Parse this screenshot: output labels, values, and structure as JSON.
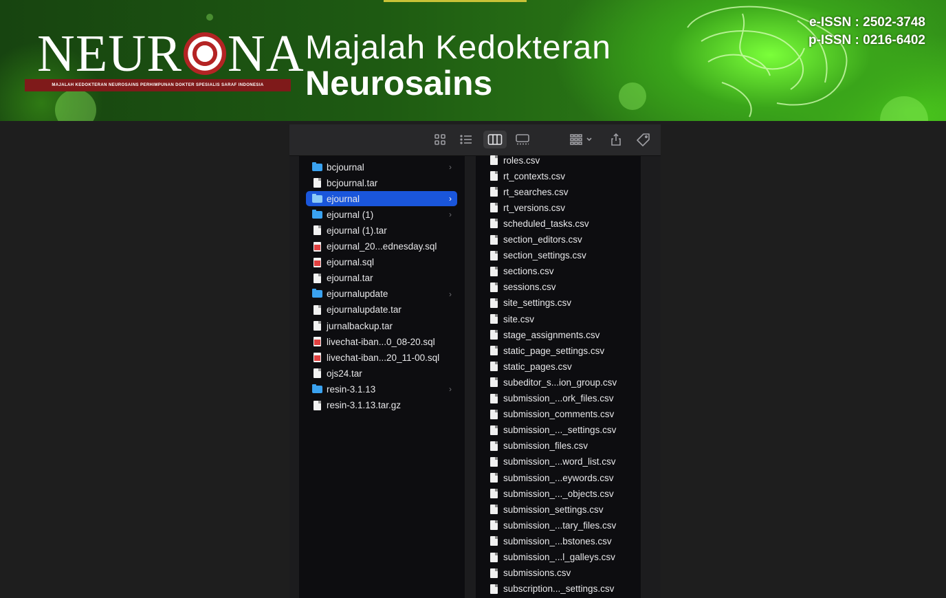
{
  "banner": {
    "logo": "NEUR◎NA",
    "logo_left": "NEUR",
    "logo_right": "NA",
    "logo_tagline": "MAJALAH KEDOKTERAN NEUROSAINS PERHIMPUNAN DOKTER SPESIALIS SARAF INDONESIA",
    "title_line1": "Majalah Kedokteran",
    "title_line2": "Neurosains",
    "eissn": "e-ISSN : 2502-3748",
    "pissn": "p-ISSN : 0216-6402",
    "colors": {
      "green_dark": "#174410",
      "green_glow": "#7bff3a",
      "strip_red": "#7f1a1a"
    }
  },
  "toolbar": {
    "buttons": [
      {
        "icon": "icon-view-grid-icon"
      },
      {
        "icon": "list-view-icon"
      },
      {
        "icon": "column-view-icon",
        "active": true
      },
      {
        "icon": "gallery-view-icon"
      },
      {
        "icon": "group-by-icon"
      },
      {
        "icon": "share-icon"
      },
      {
        "icon": "tag-icon"
      }
    ]
  },
  "column1": {
    "items": [
      {
        "name": "bcjournal",
        "kind": "folder",
        "has_children": true
      },
      {
        "name": "bcjournal.tar",
        "kind": "file"
      },
      {
        "name": "ejournal",
        "kind": "folder",
        "has_children": true,
        "selected": true
      },
      {
        "name": "ejournal (1)",
        "kind": "folder",
        "has_children": true
      },
      {
        "name": "ejournal (1).tar",
        "kind": "file"
      },
      {
        "name": "ejournal_20...ednesday.sql",
        "kind": "sql"
      },
      {
        "name": "ejournal.sql",
        "kind": "sql"
      },
      {
        "name": "ejournal.tar",
        "kind": "file"
      },
      {
        "name": "ejournalupdate",
        "kind": "folder",
        "has_children": true
      },
      {
        "name": "ejournalupdate.tar",
        "kind": "file"
      },
      {
        "name": "jurnalbackup.tar",
        "kind": "file"
      },
      {
        "name": "livechat-iban...0_08-20.sql",
        "kind": "sql"
      },
      {
        "name": "livechat-iban...20_11-00.sql",
        "kind": "sql"
      },
      {
        "name": "ojs24.tar",
        "kind": "file"
      },
      {
        "name": "resin-3.1.13",
        "kind": "folder",
        "has_children": true
      },
      {
        "name": "resin-3.1.13.tar.gz",
        "kind": "file"
      }
    ]
  },
  "column2": {
    "items": [
      "roles.csv",
      "rt_contexts.csv",
      "rt_searches.csv",
      "rt_versions.csv",
      "scheduled_tasks.csv",
      "section_editors.csv",
      "section_settings.csv",
      "sections.csv",
      "sessions.csv",
      "site_settings.csv",
      "site.csv",
      "stage_assignments.csv",
      "static_page_settings.csv",
      "static_pages.csv",
      "subeditor_s...ion_group.csv",
      "submission_...ork_files.csv",
      "submission_comments.csv",
      "submission_..._settings.csv",
      "submission_files.csv",
      "submission_...word_list.csv",
      "submission_...eywords.csv",
      "submission_..._objects.csv",
      "submission_settings.csv",
      "submission_...tary_files.csv",
      "submission_...bstones.csv",
      "submission_...l_galleys.csv",
      "submissions.csv",
      "subscription..._settings.csv"
    ]
  }
}
